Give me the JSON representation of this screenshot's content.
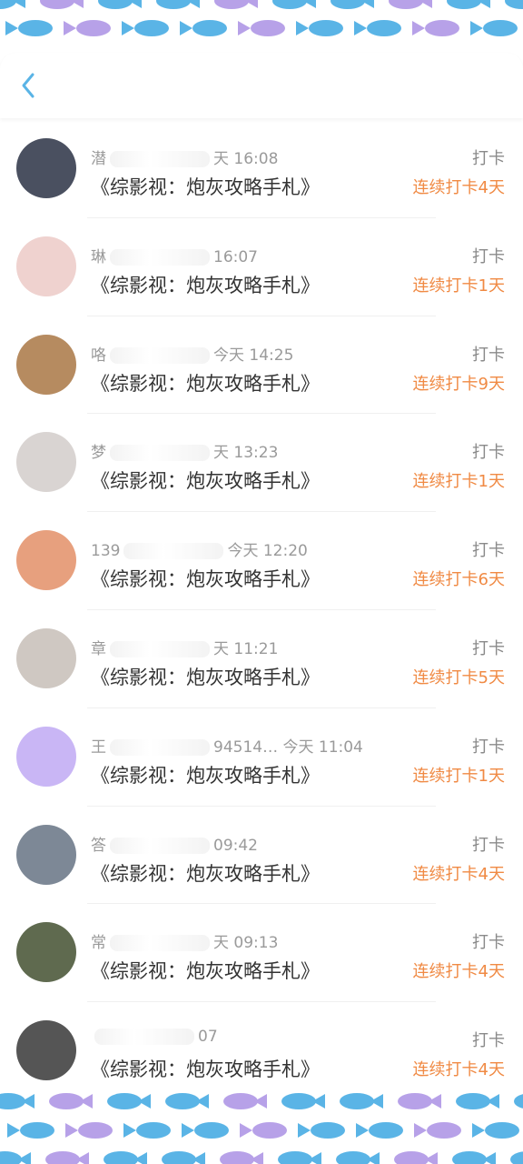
{
  "back_icon": "chevron-left-icon",
  "colors": {
    "accent_blue": "#5ab4e6",
    "fish_purple": "#b7a1e8",
    "streak_orange": "#f08a44"
  },
  "items": [
    {
      "name": "潜",
      "time": "天 16:08",
      "title": "《综影视：炮灰攻略手札》",
      "type": "打卡",
      "streak": "连续打卡4天",
      "avatar_color": "#4a5060"
    },
    {
      "name": "琳",
      "time": "16:07",
      "title": "《综影视：炮灰攻略手札》",
      "type": "打卡",
      "streak": "连续打卡1天",
      "avatar_color": "#efd2cf"
    },
    {
      "name": "咯",
      "time": "今天 14:25",
      "title": "《综影视：炮灰攻略手札》",
      "type": "打卡",
      "streak": "连续打卡9天",
      "avatar_color": "#b68b60"
    },
    {
      "name": "梦",
      "time": "天 13:23",
      "title": "《综影视：炮灰攻略手札》",
      "type": "打卡",
      "streak": "连续打卡1天",
      "avatar_color": "#d9d4d2"
    },
    {
      "name": "139",
      "time": "今天 12:20",
      "title": "《综影视：炮灰攻略手札》",
      "type": "打卡",
      "streak": "连续打卡6天",
      "avatar_color": "#e7a07e"
    },
    {
      "name": "章",
      "time": "天 11:21",
      "title": "《综影视：炮灰攻略手札》",
      "type": "打卡",
      "streak": "连续打卡5天",
      "avatar_color": "#cfc8c2"
    },
    {
      "name": "王",
      "time": "94514…  今天 11:04",
      "title": "《综影视：炮灰攻略手札》",
      "type": "打卡",
      "streak": "连续打卡1天",
      "avatar_color": "#c9b6f5"
    },
    {
      "name": "答",
      "time": "09:42",
      "title": "《综影视：炮灰攻略手札》",
      "type": "打卡",
      "streak": "连续打卡4天",
      "avatar_color": "#7d8896"
    },
    {
      "name": "常",
      "time": "天 09:13",
      "title": "《综影视：炮灰攻略手札》",
      "type": "打卡",
      "streak": "连续打卡4天",
      "avatar_color": "#5f6a4f"
    },
    {
      "name": "",
      "time": "07",
      "title": "《综影视：炮灰攻略手札》",
      "type": "打卡",
      "streak": "连续打卡4天",
      "avatar_color": "#555555"
    }
  ]
}
